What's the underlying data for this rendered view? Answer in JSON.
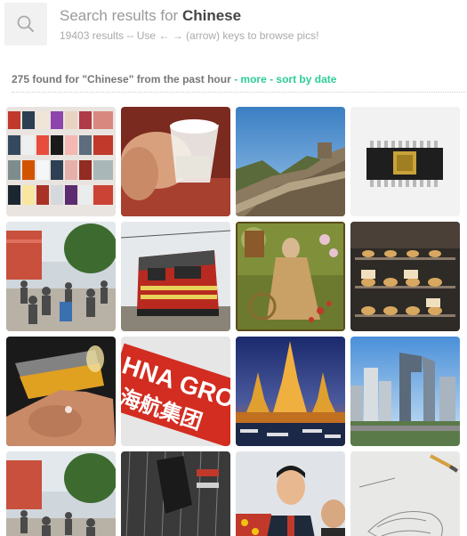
{
  "header": {
    "search_icon": "search-icon",
    "title_prefix": "Search results for ",
    "query": "Chinese",
    "subtitle": "19403 results -- Use ← → (arrow) keys to browse pics!"
  },
  "filter": {
    "summary": "275 found for \"Chinese\" from the past hour",
    "dash1": " - ",
    "more_label": "more",
    "dash2": " - ",
    "sort_label": "sort by date"
  },
  "results": [
    {
      "subject": "magazines-on-wall"
    },
    {
      "subject": "hand-holding-glass"
    },
    {
      "subject": "great-wall"
    },
    {
      "subject": "microchip"
    },
    {
      "subject": "crowd-street"
    },
    {
      "subject": "red-train"
    },
    {
      "subject": "painting-woman-flowers"
    },
    {
      "subject": "pastry-display"
    },
    {
      "subject": "beer-glass"
    },
    {
      "subject": "hna-group-sign",
      "sign_text": "HNA GRO",
      "sign_text_cn": "海航集团"
    },
    {
      "subject": "thai-temple"
    },
    {
      "subject": "city-skyline"
    },
    {
      "subject": "crowd-street-2"
    },
    {
      "subject": "rain-window-poster"
    },
    {
      "subject": "xi-jinping"
    },
    {
      "subject": "sketch-drawing"
    }
  ]
}
